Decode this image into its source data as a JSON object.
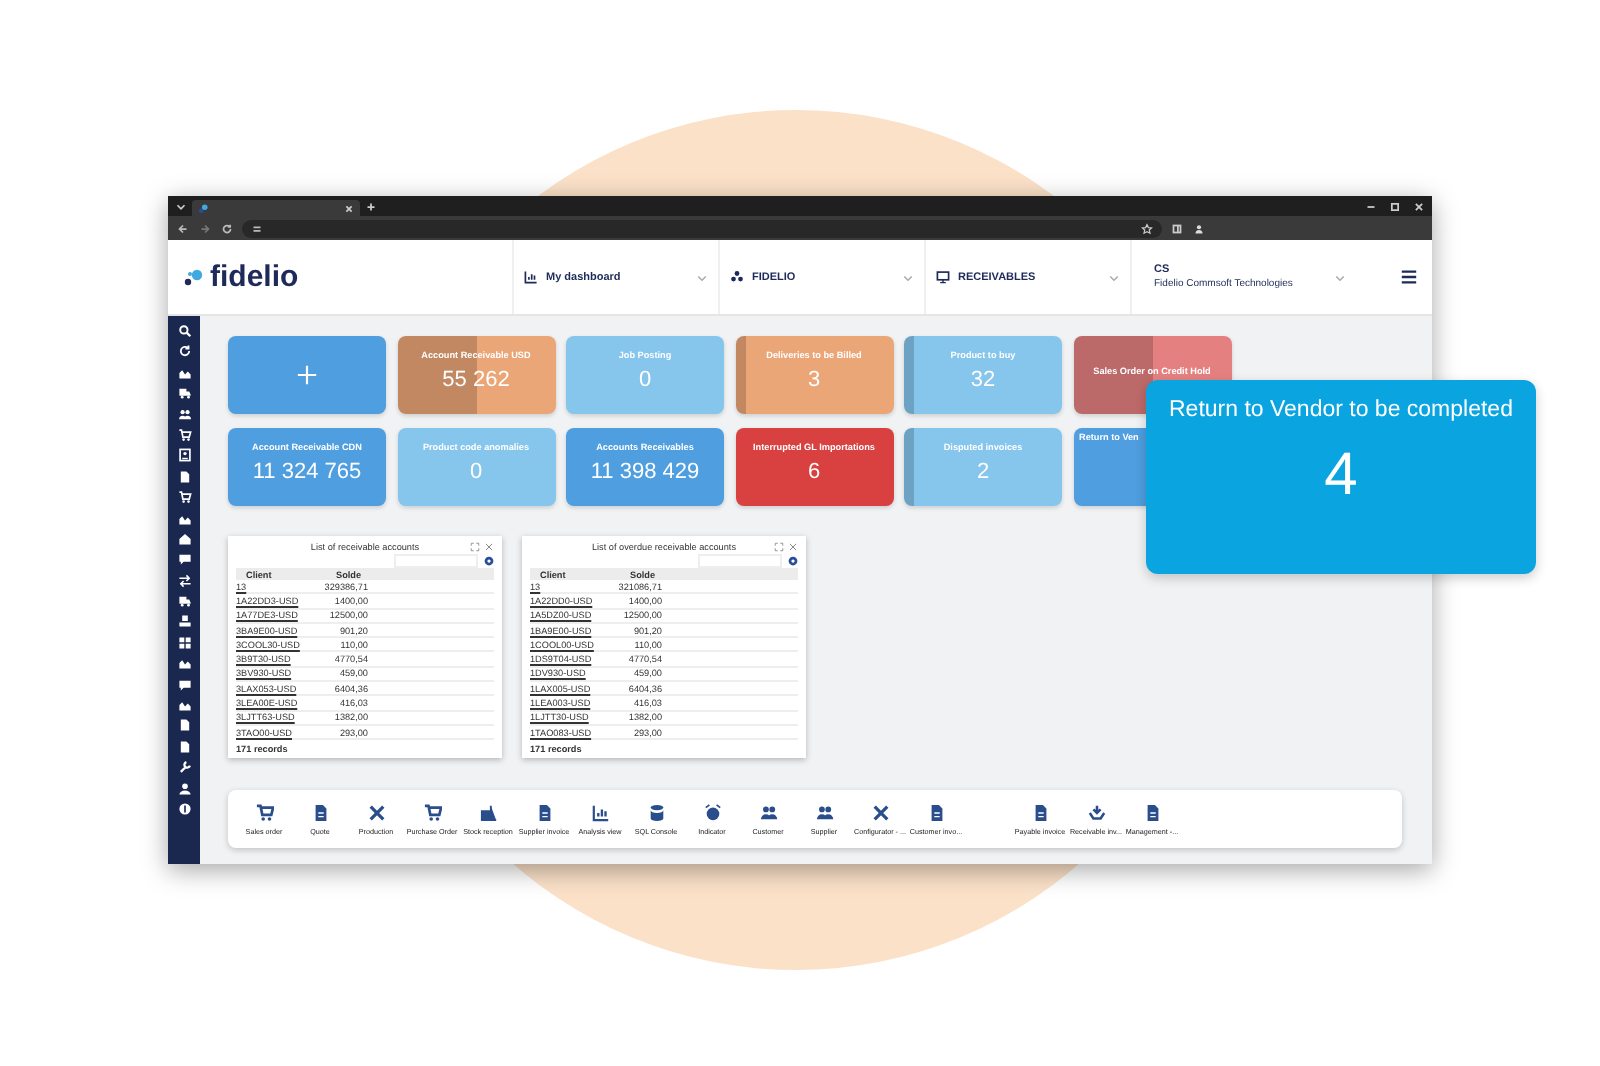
{
  "header": {
    "logo": "fidelio",
    "nav": [
      {
        "label": "My dashboard"
      },
      {
        "label": "FIDELIO"
      },
      {
        "label": "RECEIVABLES"
      }
    ],
    "company": {
      "code": "CS",
      "name": "Fidelio Commsoft Technologies"
    }
  },
  "tiles": [
    {
      "kind": "add",
      "color": "#4f9ee0"
    },
    {
      "kind": "split",
      "title": "Account Receivable USD",
      "value": "55 262",
      "color": "#eba678"
    },
    {
      "kind": "plain",
      "title": "Job Posting",
      "value": "0",
      "color": "#86c5ec"
    },
    {
      "kind": "strip",
      "title": "Deliveries to be Billed",
      "value": "3",
      "color": "#eba678"
    },
    {
      "kind": "strip",
      "title": "Product to buy",
      "value": "32",
      "color": "#86c5ec"
    },
    {
      "kind": "split",
      "title": "Sales Order on Credit Hold",
      "color": "#e58080"
    },
    {
      "kind": "plain",
      "title": "Account Receivable CDN",
      "value": "11 324 765",
      "color": "#4f9ee0"
    },
    {
      "kind": "plain",
      "title": "Product code anomalies",
      "value": "0",
      "color": "#86c5ec"
    },
    {
      "kind": "plain",
      "title": "Accounts Receivables",
      "value": "11 398 429",
      "color": "#4f9ee0"
    },
    {
      "kind": "plain",
      "title": "Interrupted GL Importations",
      "value": "6",
      "color": "#d94040"
    },
    {
      "kind": "strip",
      "title": "Disputed invoices",
      "value": "2",
      "color": "#86c5ec"
    },
    {
      "kind": "partial",
      "title": "Return to Ven",
      "color": "#4f9ee0"
    }
  ],
  "tables": [
    {
      "title": "List of receivable accounts",
      "columns": [
        "Client",
        "Solde"
      ],
      "rows": [
        [
          "13",
          "329386,71"
        ],
        [
          "1A22DD3-USD",
          "1400,00"
        ],
        [
          "1A77DE3-USD",
          "12500,00"
        ],
        [
          "3BA9E00-USD",
          "901,20"
        ],
        [
          "3COOL30-USD",
          "110,00"
        ],
        [
          "3B9T30-USD",
          "4770,54"
        ],
        [
          "3BV930-USD",
          "459,00"
        ],
        [
          "3LAX053-USD",
          "6404,36"
        ],
        [
          "3LEA00E-USD",
          "416,03"
        ],
        [
          "3LJTT63-USD",
          "1382,00"
        ],
        [
          "3TAO00-USD",
          "293,00"
        ]
      ],
      "footer": "171 records"
    },
    {
      "title": "List of overdue receivable accounts",
      "columns": [
        "Client",
        "Solde"
      ],
      "rows": [
        [
          "13",
          "321086,71"
        ],
        [
          "1A22DD0-USD",
          "1400,00"
        ],
        [
          "1A5DZ00-USD",
          "12500,00"
        ],
        [
          "1BA9E00-USD",
          "901,20"
        ],
        [
          "1COOL00-USD",
          "110,00"
        ],
        [
          "1DS9T04-USD",
          "4770,54"
        ],
        [
          "1DV930-USD",
          "459,00"
        ],
        [
          "1LAX005-USD",
          "6404,36"
        ],
        [
          "1LEA003-USD",
          "416,03"
        ],
        [
          "1LJTT30-USD",
          "1382,00"
        ],
        [
          "1TAO083-USD",
          "293,00"
        ]
      ],
      "footer": "171 records"
    }
  ],
  "shortcut_groups": [
    [
      "Sales order",
      "Quote",
      "Production",
      "Purchase Order",
      "Stock reception",
      "Supplier invoice",
      "Analysis view",
      "SQL Console",
      "Indicator",
      "Customer",
      "Supplier",
      "Configurator - ...",
      "Customer invo..."
    ],
    [
      "Payable invoice",
      "Receivable inv...",
      "Management -..."
    ]
  ],
  "callout": {
    "title": "Return to Vendor to be completed",
    "value": "4"
  }
}
